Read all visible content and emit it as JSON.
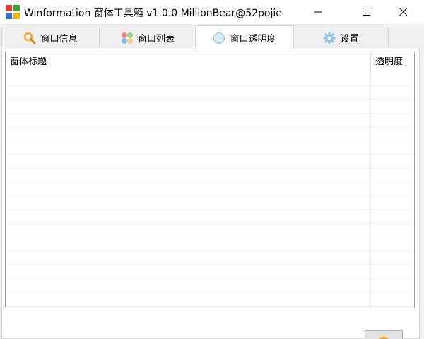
{
  "window": {
    "title": "Winformation 窗体工具箱 v1.0.0  MillionBear@52pojie"
  },
  "tabs": [
    {
      "label": "窗口信息",
      "icon": "magnifier-icon",
      "active": false
    },
    {
      "label": "窗口列表",
      "icon": "colored-dots-icon",
      "active": false
    },
    {
      "label": "窗口透明度",
      "icon": "blue-circle-icon",
      "active": true
    },
    {
      "label": "设置",
      "icon": "gear-icon",
      "active": false
    }
  ],
  "listview": {
    "columns": [
      "窗体标题",
      "透明度"
    ],
    "rows": [
      [
        "",
        ""
      ],
      [
        "",
        ""
      ],
      [
        "",
        ""
      ],
      [
        "",
        ""
      ],
      [
        "",
        ""
      ],
      [
        "",
        ""
      ],
      [
        "",
        ""
      ],
      [
        "",
        ""
      ],
      [
        "",
        ""
      ],
      [
        "",
        ""
      ],
      [
        "",
        ""
      ],
      [
        "",
        ""
      ],
      [
        "",
        ""
      ],
      [
        "",
        ""
      ],
      [
        "",
        ""
      ],
      [
        "",
        ""
      ],
      [
        "",
        ""
      ]
    ]
  },
  "colors": {
    "accent_orange": "#f5a623",
    "tab_icon_blue": "#bcdcf5"
  }
}
